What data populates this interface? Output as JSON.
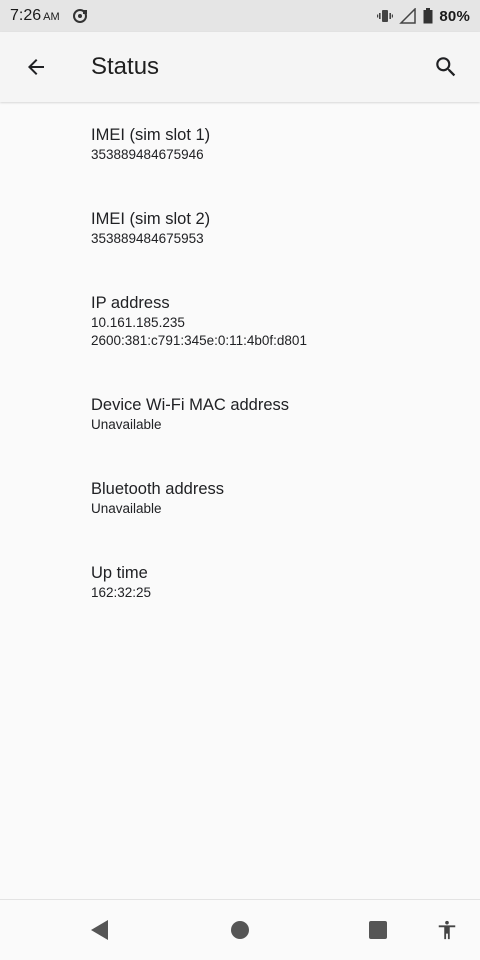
{
  "status_bar": {
    "time": "7:26",
    "ampm": "AM",
    "battery": "80%",
    "icons": [
      "sync-icon",
      "vibrate-icon",
      "signal-icon",
      "battery-icon"
    ]
  },
  "app_bar": {
    "title": "Status",
    "back_icon": "arrow-left-icon",
    "search_icon": "search-icon"
  },
  "items": [
    {
      "title": "IMEI (sim slot 1)",
      "summary": [
        "353889484675946"
      ]
    },
    {
      "title": "IMEI (sim slot 2)",
      "summary": [
        "353889484675953"
      ]
    },
    {
      "title": "IP address",
      "summary": [
        "10.161.185.235",
        "2600:381:c791:345e:0:11:4b0f:d801"
      ]
    },
    {
      "title": "Device Wi-Fi MAC address",
      "summary": [
        "Unavailable"
      ]
    },
    {
      "title": "Bluetooth address",
      "summary": [
        "Unavailable"
      ]
    },
    {
      "title": "Up time",
      "summary": [
        "162:32:25"
      ]
    }
  ],
  "nav_bar": {
    "buttons": [
      "back-triangle-icon",
      "home-circle-icon",
      "recents-square-icon",
      "accessibility-icon"
    ]
  },
  "colors": {
    "status_bar_bg": "#e5e5e5",
    "app_bar_bg": "#f5f5f5",
    "page_bg": "#fafafa",
    "text": "#202124",
    "nav_icon": "#555555"
  }
}
